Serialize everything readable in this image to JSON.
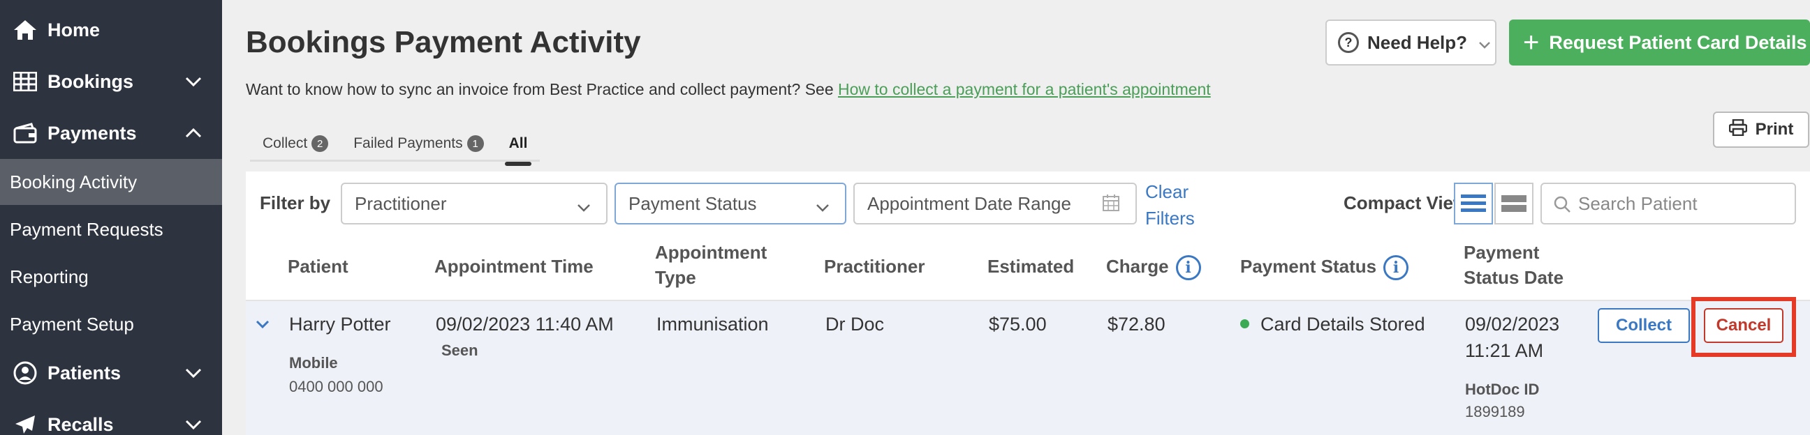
{
  "sidebar": {
    "items": [
      {
        "label": "Home",
        "icon": "home-icon"
      },
      {
        "label": "Bookings",
        "icon": "grid-icon"
      },
      {
        "label": "Payments",
        "icon": "wallet-icon"
      },
      {
        "label": "Patients",
        "icon": "user-icon"
      },
      {
        "label": "Recalls",
        "icon": "paper-plane-icon"
      }
    ],
    "sub_items": [
      {
        "label": "Booking Activity",
        "active": true
      },
      {
        "label": "Payment Requests"
      },
      {
        "label": "Reporting"
      },
      {
        "label": "Payment Setup"
      }
    ]
  },
  "header": {
    "title": "Bookings Payment Activity",
    "help_label": "Need Help?",
    "request_label": "Request Patient Card Details",
    "intro_text": "Want to know how to sync an invoice from Best Practice and collect payment? See ",
    "intro_link": "How to collect a payment for a patient's appointment",
    "print_label": "Print"
  },
  "tabs": [
    {
      "label": "Collect",
      "count": "2"
    },
    {
      "label": "Failed Payments",
      "count": "1"
    },
    {
      "label": "All",
      "active": true
    }
  ],
  "filters": {
    "label": "Filter by",
    "practitioner": "Practitioner",
    "payment_status": "Payment Status",
    "date_range": "Appointment Date Range",
    "clear_line1": "Clear",
    "clear_line2": "Filters",
    "compact_label": "Compact View",
    "search_placeholder": "Search Patient"
  },
  "table": {
    "headers": {
      "patient": "Patient",
      "appt_time": "Appointment Time",
      "appt_type_1": "Appointment",
      "appt_type_2": "Type",
      "practitioner": "Practitioner",
      "estimated": "Estimated",
      "charge": "Charge",
      "payment_status": "Payment Status",
      "status_date_1": "Payment",
      "status_date_2": "Status Date"
    },
    "row": {
      "patient": "Harry Potter",
      "mobile_label": "Mobile",
      "mobile": "0400 000 000",
      "appt_time": "09/02/2023 11:40 AM",
      "seen": "Seen",
      "appt_type": "Immunisation",
      "practitioner": "Dr Doc",
      "estimated": "$75.00",
      "charge": "$72.80",
      "status": "Card Details Stored",
      "status_date_1": "09/02/2023",
      "status_date_2": "11:21 AM",
      "hotdoc_label": "HotDoc ID",
      "hotdoc_id": "1899189",
      "collect_label": "Collect",
      "cancel_label": "Cancel"
    }
  },
  "colors": {
    "sidebar": "#2d3440",
    "accent_green": "#4caf5e",
    "link_blue": "#3a78c3",
    "cancel_red": "#c0392b",
    "highlight": "#e43a26"
  }
}
